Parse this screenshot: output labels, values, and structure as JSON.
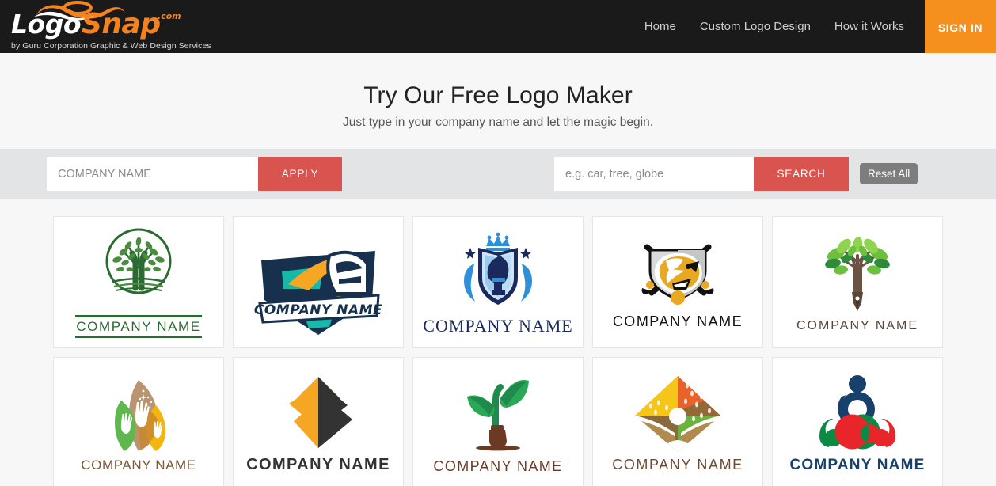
{
  "header": {
    "brand": {
      "word_1": "Logo",
      "word_2": "Snap",
      "domain": ".com",
      "tagline": "by Guru Corporation Graphic & Web Design Services",
      "accent_color": "#f5821f"
    },
    "nav_links": [
      {
        "label": "Home",
        "name": "home"
      },
      {
        "label": "Custom Logo Design",
        "name": "custom-logo-design"
      },
      {
        "label": "How it Works",
        "name": "how-it-works"
      }
    ],
    "sign_in_label": "SIGN IN",
    "sign_in_color": "#f5901f"
  },
  "hero": {
    "title": "Try Our Free Logo Maker",
    "subtitle": "Just type in your company name and let the magic begin."
  },
  "toolbar": {
    "company_input": {
      "value": "",
      "placeholder": "COMPANY NAME"
    },
    "apply_label": "APPLY",
    "keyword_input": {
      "value": "",
      "placeholder": "e.g. car, tree, globe"
    },
    "search_label": "SEARCH",
    "reset_label": "Reset All",
    "button_color": "#d9534f",
    "reset_color": "#7d7d7d",
    "band_color": "#e3e4e6"
  },
  "results": {
    "company_name_text": "COMPANY NAME",
    "logos": [
      {
        "id": "tree-circle-logo",
        "icon": "circular-tree-icon",
        "name_style": "boxed-sans",
        "color": "#2b6b32"
      },
      {
        "id": "train-emblem-logo",
        "icon": "train-shield-icon",
        "name_style": "italic-banner",
        "color": "#17304d"
      },
      {
        "id": "chess-knight-shield-logo",
        "icon": "knight-crown-shield-icon",
        "name_style": "serif",
        "color": "#1b2a5e"
      },
      {
        "id": "eagle-hockey-logo",
        "icon": "eagle-crossed-sticks-icon",
        "name_style": "wide-sans",
        "color": "#111111"
      },
      {
        "id": "pen-tree-logo",
        "icon": "tree-pen-nib-icon",
        "name_style": "thin-sans",
        "color": "#5a4636"
      },
      {
        "id": "hands-leaves-logo",
        "icon": "three-leaves-hands-icon",
        "name_style": "plain-sans",
        "color": "#7a5a3c"
      },
      {
        "id": "pyramid-steps-logo",
        "icon": "pyramid-diamond-icon",
        "name_style": "bold-sans",
        "color": "#333333"
      },
      {
        "id": "sprout-inkpot-logo",
        "icon": "seedling-ink-bottle-icon",
        "name_style": "rounded-sans",
        "color": "#6b3a25"
      },
      {
        "id": "diamond-person-logo",
        "icon": "colored-diamond-person-icon",
        "name_style": "plain-sans",
        "color": "#6b4a36"
      },
      {
        "id": "three-people-logo",
        "icon": "three-people-circle-icon",
        "name_style": "bold-sans",
        "color": "#17406b"
      }
    ]
  }
}
